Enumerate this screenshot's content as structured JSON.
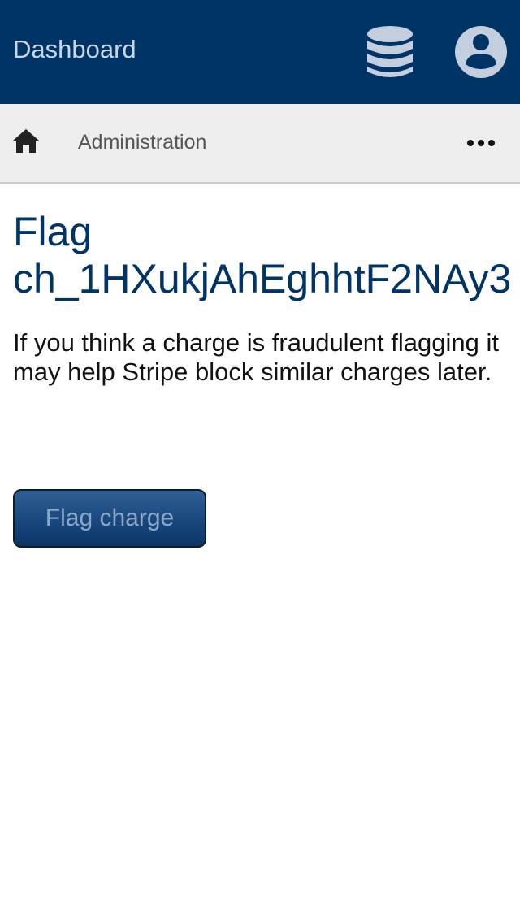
{
  "header": {
    "title": "Dashboard",
    "icons": {
      "database": "database-icon",
      "user": "user-circle-icon"
    },
    "icon_color": "#c3cfde",
    "background": "#003366"
  },
  "nav": {
    "home_icon": "home-icon",
    "breadcrumb": "Administration",
    "more_icon": "ellipsis-icon",
    "background": "#eeeeee"
  },
  "main": {
    "heading_line1": "Flag",
    "heading_line2": "ch_1HXukjAhEghhtF2NAy3",
    "description": "If you think a charge is fraudulent flagging it may help Stripe block similar charges later.",
    "button_label": "Flag charge",
    "accent_color": "#003366"
  }
}
